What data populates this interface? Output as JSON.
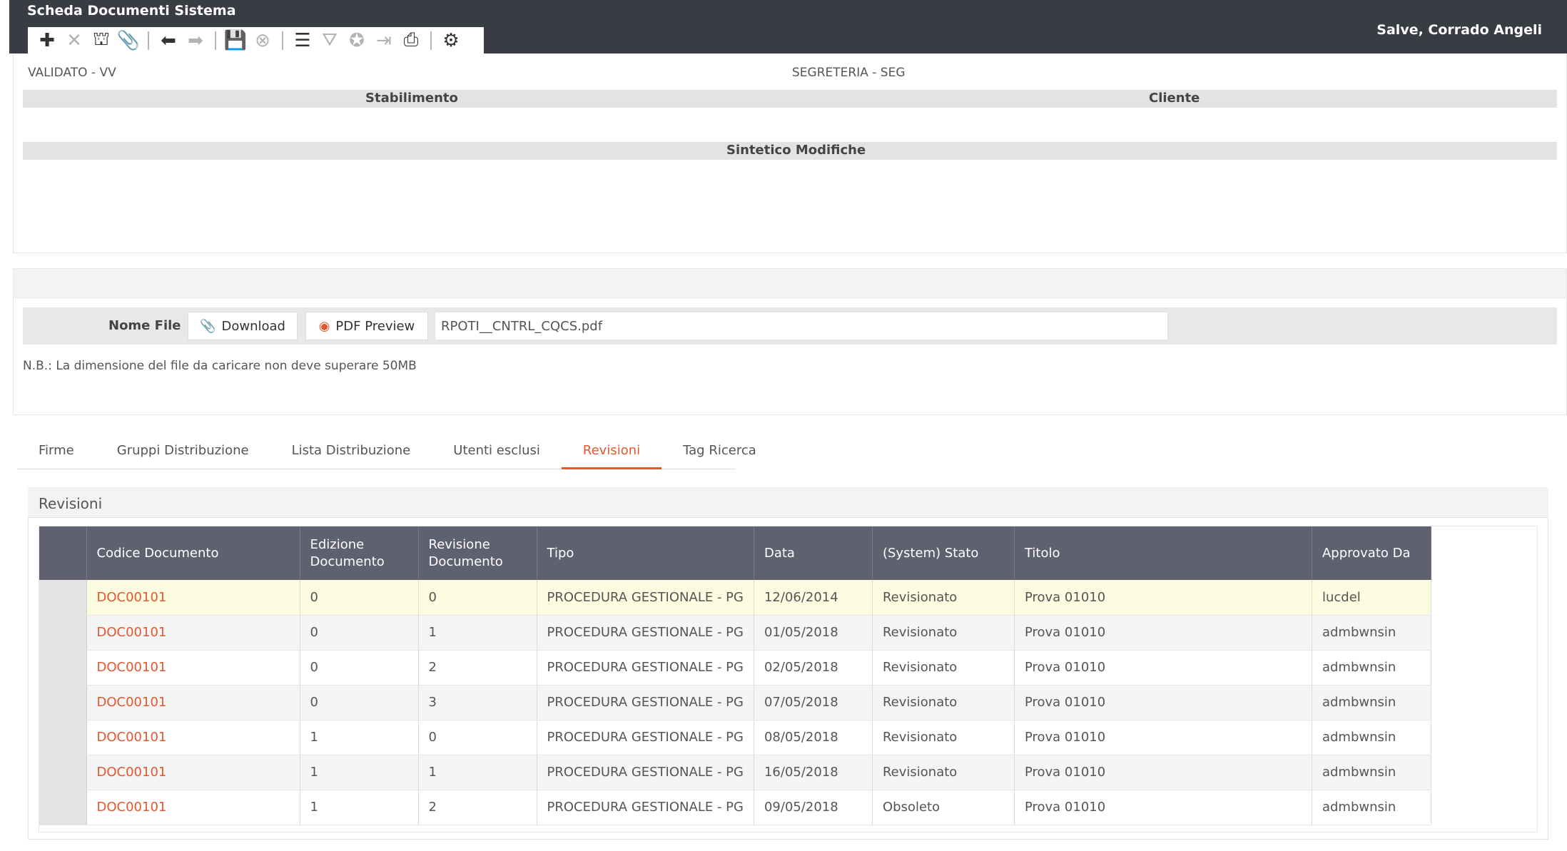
{
  "app": {
    "title": "Scheda Documenti Sistema",
    "greeting": "Salve, Corrado Angeli"
  },
  "toolbar": {
    "groups": [
      [
        {
          "icon": "plus-icon",
          "glyph": "✚",
          "enabled": true
        },
        {
          "icon": "close-icon",
          "glyph": "✕",
          "enabled": false
        },
        {
          "icon": "hierarchy-icon",
          "glyph": "⛫",
          "enabled": true
        },
        {
          "icon": "paperclip-icon",
          "glyph": "📎",
          "enabled": true
        }
      ],
      [
        {
          "icon": "arrow-left-icon",
          "glyph": "⬅",
          "enabled": true
        },
        {
          "icon": "arrow-right-icon",
          "glyph": "➡",
          "enabled": false
        }
      ],
      [
        {
          "icon": "save-icon",
          "glyph": "💾",
          "enabled": false
        },
        {
          "icon": "cancel-icon",
          "glyph": "⊗",
          "enabled": false
        }
      ],
      [
        {
          "icon": "list-icon",
          "glyph": "☰",
          "enabled": true
        },
        {
          "icon": "filter-icon",
          "glyph": "⛛",
          "enabled": false
        },
        {
          "icon": "certificate-icon",
          "glyph": "✪",
          "enabled": false
        },
        {
          "icon": "export-icon",
          "glyph": "⇥",
          "enabled": false
        },
        {
          "icon": "print-icon",
          "glyph": "⎙",
          "enabled": true
        }
      ],
      [
        {
          "icon": "gear-icon",
          "glyph": "⚙",
          "enabled": true
        }
      ]
    ]
  },
  "doc": {
    "stato_value": "VALIDATO - VV",
    "area_value": "SEGRETERIA - SEG",
    "stabilimento_label": "Stabilimento",
    "cliente_label": "Cliente",
    "sintetico_label": "Sintetico Modifiche"
  },
  "file": {
    "label": "Nome File",
    "download_label": "Download",
    "preview_label": "PDF Preview",
    "filename": "RPOTI__CNTRL_CQCS.pdf",
    "note": "N.B.: La dimensione del file da caricare non deve superare 50MB"
  },
  "tabs": [
    {
      "label": "Firme",
      "active": false
    },
    {
      "label": "Gruppi Distribuzione",
      "active": false
    },
    {
      "label": "Lista Distribuzione",
      "active": false
    },
    {
      "label": "Utenti esclusi",
      "active": false
    },
    {
      "label": "Revisioni",
      "active": true
    },
    {
      "label": "Tag Ricerca",
      "active": false
    }
  ],
  "revisioni": {
    "title": "Revisioni",
    "columns": [
      "Codice Documento",
      "Edizione Documento",
      "Revisione Documento",
      "Tipo",
      "Data",
      "(System) Stato",
      "Titolo",
      "Approvato Da"
    ],
    "rows": [
      [
        "DOC00101",
        "0",
        "0",
        "PROCEDURA GESTIONALE - PG",
        "12/06/2014",
        "Revisionato",
        "Prova 01010",
        "lucdel"
      ],
      [
        "DOC00101",
        "0",
        "1",
        "PROCEDURA GESTIONALE - PG",
        "01/05/2018",
        "Revisionato",
        "Prova 01010",
        "admbwnsin"
      ],
      [
        "DOC00101",
        "0",
        "2",
        "PROCEDURA GESTIONALE - PG",
        "02/05/2018",
        "Revisionato",
        "Prova 01010",
        "admbwnsin"
      ],
      [
        "DOC00101",
        "0",
        "3",
        "PROCEDURA GESTIONALE - PG",
        "07/05/2018",
        "Revisionato",
        "Prova 01010",
        "admbwnsin"
      ],
      [
        "DOC00101",
        "1",
        "0",
        "PROCEDURA GESTIONALE - PG",
        "08/05/2018",
        "Revisionato",
        "Prova 01010",
        "admbwnsin"
      ],
      [
        "DOC00101",
        "1",
        "1",
        "PROCEDURA GESTIONALE - PG",
        "16/05/2018",
        "Revisionato",
        "Prova 01010",
        "admbwnsin"
      ],
      [
        "DOC00101",
        "1",
        "2",
        "PROCEDURA GESTIONALE - PG",
        "09/05/2018",
        "Obsoleto",
        "Prova 01010",
        "admbwnsin"
      ]
    ],
    "highlight_row": 0
  }
}
